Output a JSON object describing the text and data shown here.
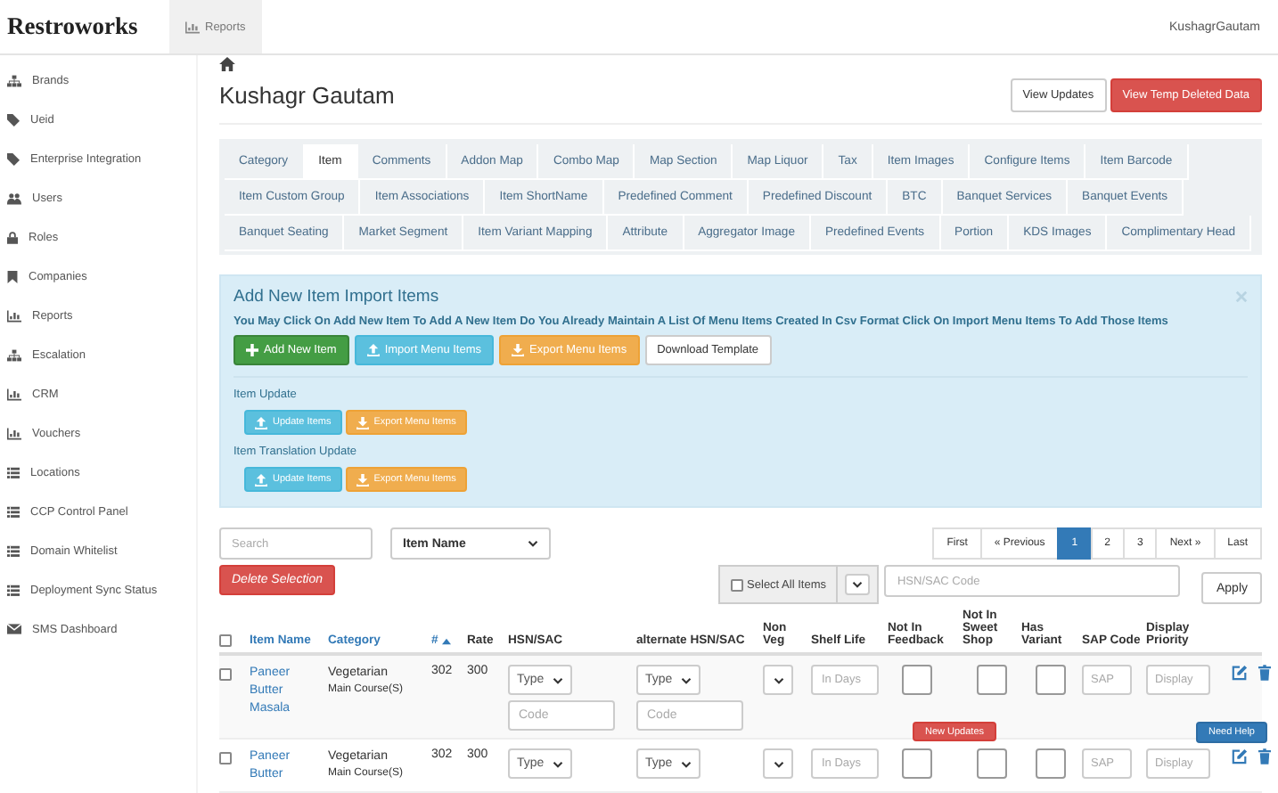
{
  "navbar": {
    "logo": "Restroworks",
    "nav": [
      {
        "label": "Reports",
        "selected": true
      }
    ],
    "user": "KushagrGautam"
  },
  "sidebar": {
    "items": [
      {
        "label": "Brands"
      },
      {
        "label": "Ueid"
      },
      {
        "label": "Enterprise Integration"
      },
      {
        "label": "Users"
      },
      {
        "label": "Roles"
      },
      {
        "label": "Companies"
      },
      {
        "label": "Reports"
      },
      {
        "label": "Escalation"
      },
      {
        "label": "CRM"
      },
      {
        "label": "Vouchers"
      },
      {
        "label": "Locations"
      },
      {
        "label": "CCP Control Panel"
      },
      {
        "label": "Domain Whitelist"
      },
      {
        "label": "Deployment Sync Status"
      },
      {
        "label": "SMS Dashboard"
      }
    ]
  },
  "page": {
    "title": "Kushagr Gautam",
    "actions": [
      {
        "label": "View Updates",
        "kind": "default"
      },
      {
        "label": "View Temp Deleted Data",
        "kind": "danger"
      }
    ]
  },
  "tab_rows": [
    {
      "tabs": [
        {
          "label": "Category",
          "selected": false
        },
        {
          "label": "Item",
          "selected": true
        },
        {
          "label": "Comments",
          "selected": false
        },
        {
          "label": "Addon Map",
          "selected": false
        },
        {
          "label": "Combo Map",
          "selected": false
        },
        {
          "label": "Map Section",
          "selected": false
        },
        {
          "label": "Map Liquor",
          "selected": false
        },
        {
          "label": "Tax",
          "selected": false
        },
        {
          "label": "Item Images",
          "selected": false
        },
        {
          "label": "Configure Items",
          "selected": false
        },
        {
          "label": "Item Barcode",
          "selected": false
        }
      ]
    },
    {
      "tabs": [
        {
          "label": "Item Custom Group",
          "selected": false
        },
        {
          "label": "Item Associations",
          "selected": false
        },
        {
          "label": "Item ShortName",
          "selected": false
        },
        {
          "label": "Predefined Comment",
          "selected": false
        },
        {
          "label": "Predefined Discount",
          "selected": false
        },
        {
          "label": "BTC",
          "selected": false
        },
        {
          "label": "Banquet Services",
          "selected": false
        },
        {
          "label": "Banquet Events",
          "selected": false
        }
      ]
    },
    {
      "tabs": [
        {
          "label": "Banquet Seating",
          "selected": false
        },
        {
          "label": "Market Segment",
          "selected": false
        },
        {
          "label": "Item Variant Mapping",
          "selected": false
        },
        {
          "label": "Attribute",
          "selected": false
        },
        {
          "label": "Aggregator Image",
          "selected": false
        },
        {
          "label": "Predefined Events",
          "selected": false
        },
        {
          "label": "Portion",
          "selected": false
        },
        {
          "label": "KDS Images",
          "selected": false
        },
        {
          "label": "Complimentary Head",
          "selected": false
        }
      ]
    }
  ],
  "import_panel": {
    "title": "Add New Item Import Items",
    "description": "You May Click On Add New Item To Add A New Item Do You Already Maintain A List Of Menu Items Created In Csv Format Click On Import Menu Items To Add Those Items",
    "buttons": [
      {
        "label": "Add New Item",
        "kind": "success"
      },
      {
        "label": "Import Menu Items",
        "kind": "info"
      },
      {
        "label": "Export Menu Items",
        "kind": "warning"
      },
      {
        "label": "Download Template",
        "kind": "default"
      }
    ],
    "sections": [
      {
        "label": "Item Update",
        "buttons": [
          {
            "label": "Update Items",
            "kind": "info"
          },
          {
            "label": "Export Menu Items",
            "kind": "warning"
          }
        ]
      },
      {
        "label": "Item Translation Update",
        "buttons": [
          {
            "label": "Update Items",
            "kind": "info"
          },
          {
            "label": "Export Menu Items",
            "kind": "warning"
          }
        ]
      }
    ]
  },
  "filters": {
    "search": {
      "placeholder": "Search"
    },
    "sort_field": {
      "value": "Item Name"
    },
    "delete_button": "Delete Selection",
    "pagination": [
      {
        "label": "First",
        "selected": false
      },
      {
        "label": "« Previous",
        "selected": false
      },
      {
        "label": "1",
        "selected": true
      },
      {
        "label": "2",
        "selected": false
      },
      {
        "label": "3",
        "selected": false
      },
      {
        "label": "Next »",
        "selected": false
      },
      {
        "label": "Last",
        "selected": false
      }
    ],
    "select_all": {
      "label": "Select All Items",
      "checked": false
    },
    "hsn_code": {
      "placeholder": "HSN/SAC Code"
    },
    "apply_button": "Apply"
  },
  "table": {
    "select_all_checked": false,
    "columns": [
      {
        "label": "Item Name",
        "sortable": true,
        "sorted": false
      },
      {
        "label": "Category",
        "sortable": true,
        "sorted": false
      },
      {
        "label": "#",
        "sortable": true,
        "sorted": true
      },
      {
        "label": "Rate",
        "sortable": false,
        "sorted": false
      },
      {
        "label": "HSN/SAC",
        "sortable": false,
        "sorted": false
      },
      {
        "label": "alternate HSN/SAC",
        "sortable": false,
        "sorted": false
      },
      {
        "label": "Non Veg",
        "sortable": false,
        "sorted": false
      },
      {
        "label": "Shelf Life",
        "sortable": false,
        "sorted": false
      },
      {
        "label": "Not In Feedback",
        "sortable": false,
        "sorted": false
      },
      {
        "label": "Not In Sweet Shop",
        "sortable": false,
        "sorted": false
      },
      {
        "label": "Has Variant",
        "sortable": false,
        "sorted": false
      },
      {
        "label": "SAP Code",
        "sortable": false,
        "sorted": false
      },
      {
        "label": "Display Priority",
        "sortable": false,
        "sorted": false
      }
    ],
    "rows": [
      {
        "checked": false,
        "name": "Paneer Butter Masala",
        "category": "Vegetarian",
        "subcategory": "Main Course(S)",
        "number": "302",
        "rate": "300",
        "hsn": {
          "type": "Type",
          "code_placeholder": "Code"
        },
        "alt_hsn": {
          "type": "Type",
          "code_placeholder": "Code"
        },
        "shelf_life_placeholder": "In Days",
        "not_in_feedback": false,
        "not_in_sweet_shop": false,
        "has_variant": false,
        "sap_placeholder": "SAP",
        "display_placeholder": "Display"
      },
      {
        "checked": false,
        "name": "Paneer Butter",
        "category": "Vegetarian",
        "subcategory": "Main Course(S)",
        "number": "302",
        "rate": "300",
        "hsn": {
          "type": "Type"
        },
        "alt_hsn": {
          "type": "Type"
        },
        "shelf_life_placeholder": "In Days",
        "not_in_feedback": false,
        "not_in_sweet_shop": false,
        "has_variant": false,
        "sap_placeholder": "SAP",
        "display_placeholder": "Display"
      }
    ]
  },
  "floating_buttons": [
    {
      "label": "New Updates",
      "kind": "danger"
    },
    {
      "label": "Need Help",
      "kind": "primary"
    }
  ]
}
